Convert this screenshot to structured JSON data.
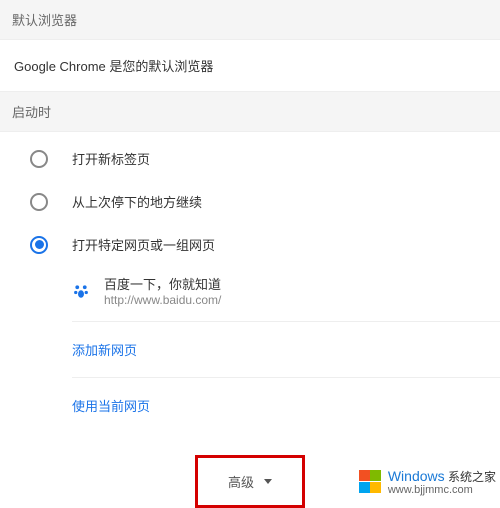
{
  "section_default_browser": "默认浏览器",
  "default_browser_msg": "Google Chrome 是您的默认浏览器",
  "section_startup": "启动时",
  "radio_new_tab": "打开新标签页",
  "radio_continue": "从上次停下的地方继续",
  "radio_specific": "打开特定网页或一组网页",
  "page_title": "百度一下，你就知道",
  "page_url": "http://www.baidu.com/",
  "add_new_page": "添加新网页",
  "use_current_pages": "使用当前网页",
  "advanced": "高级",
  "watermark_top": "Windows",
  "watermark_bottom": "系统之家",
  "watermark_url": "www.bjjmmc.com"
}
